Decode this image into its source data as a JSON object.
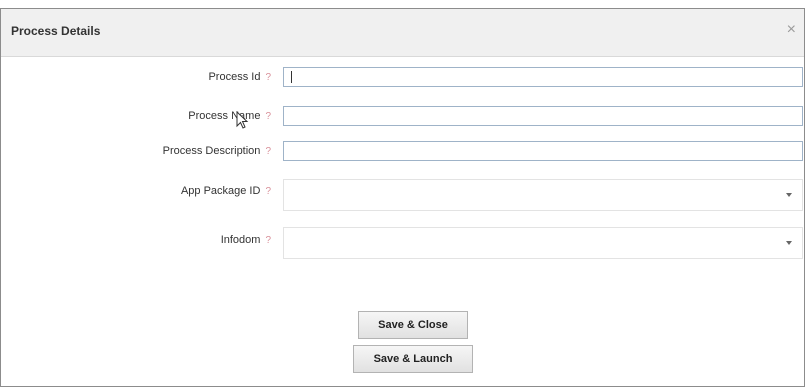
{
  "dialog": {
    "title": "Process Details",
    "close_glyph": "×"
  },
  "form": {
    "help_glyph": "?",
    "fields": [
      {
        "label": "Process Id",
        "value": "",
        "type": "text"
      },
      {
        "label": "Process Name",
        "value": "",
        "type": "text"
      },
      {
        "label": "Process Description",
        "value": "",
        "type": "text"
      },
      {
        "label": "App Package ID",
        "value": "",
        "type": "select"
      },
      {
        "label": "Infodom",
        "value": "",
        "type": "select"
      }
    ]
  },
  "buttons": {
    "save_close": "Save & Close",
    "save_launch": "Save & Launch"
  },
  "icons": {
    "close": "close-icon",
    "help": "help-icon",
    "dropdown": "chevron-down-icon",
    "pointer": "mouse-pointer-icon"
  },
  "colors": {
    "title_bar": "#f0f0f0",
    "help_marker": "#d9909a",
    "input_border": "#9fb3c8"
  }
}
